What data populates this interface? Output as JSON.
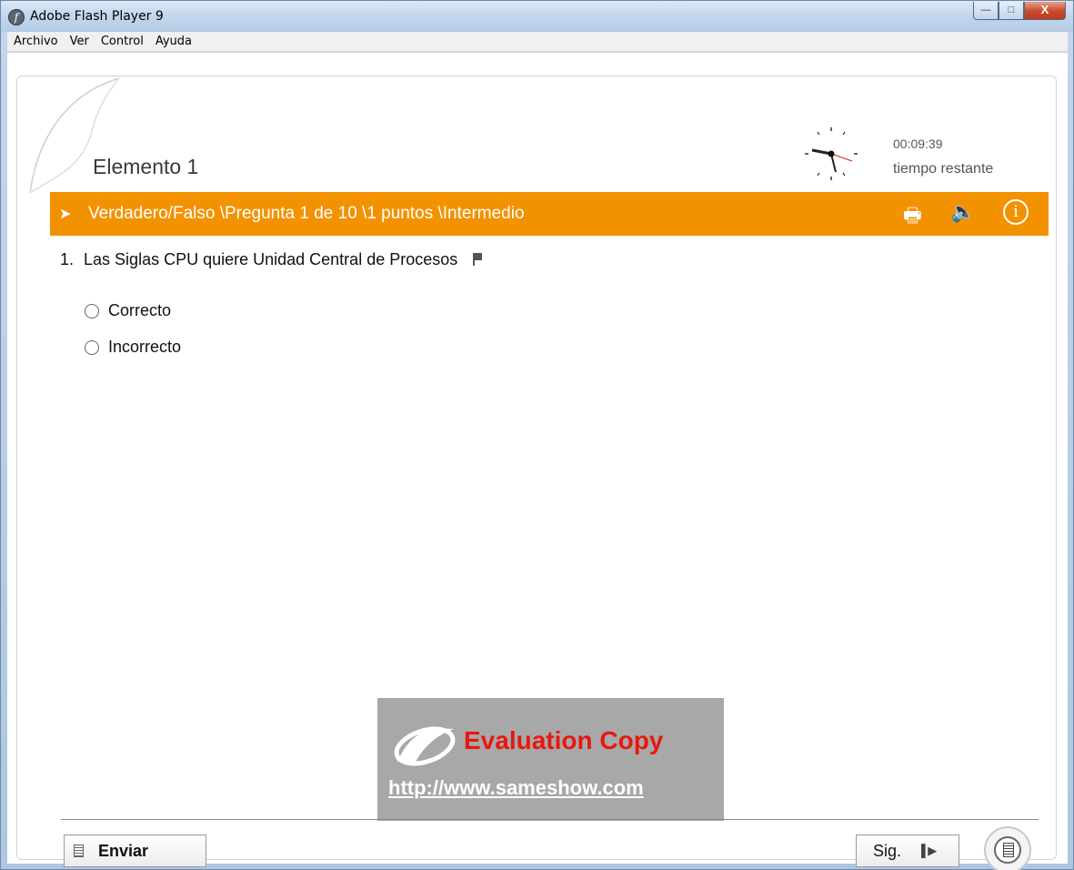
{
  "window": {
    "title": "Adobe Flash Player 9",
    "controls": {
      "minimize": "—",
      "maximize": "□",
      "close": "X"
    }
  },
  "menu": [
    "Archivo",
    "Ver",
    "Control",
    "Ayuda"
  ],
  "quiz": {
    "element_title": "Elemento 1",
    "timer": {
      "value": "00:09:39",
      "label": "tiempo restante"
    },
    "question_bar": "Verdadero/Falso \\Pregunta 1 de  10 \\1 puntos \\Intermedio",
    "question": {
      "number": "1.",
      "text": "Las Siglas CPU quiere Unidad Central de Procesos"
    },
    "options": [
      "Correcto",
      "Incorrecto"
    ],
    "submit_label": "Enviar",
    "next_label": "Sig."
  },
  "watermark": {
    "title": "Evaluation Copy",
    "url": "http://www.sameshow.com"
  },
  "icons": {
    "app": "flash-player-icon",
    "print": "print-icon",
    "sound": "speaker-icon",
    "info": "info-icon",
    "flag": "flag-icon",
    "review": "review-document-icon"
  },
  "colors": {
    "accent": "#f39200",
    "watermark_bg": "#a8a8a8",
    "watermark_title": "#e8170f"
  }
}
